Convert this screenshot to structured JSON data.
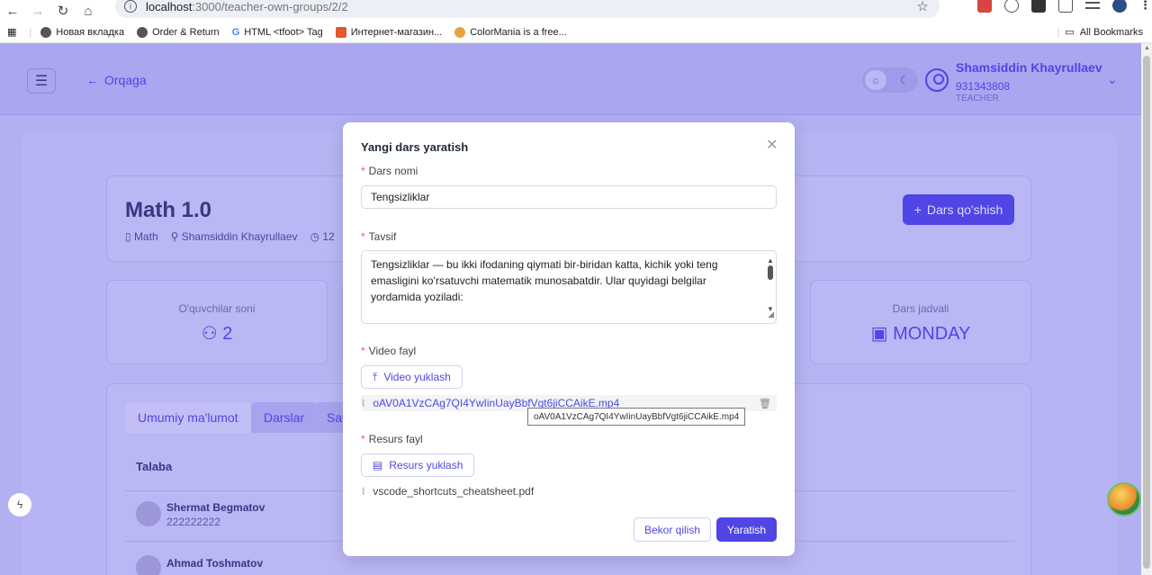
{
  "browser": {
    "url_host": "localhost",
    "url_path": ":3000/teacher-own-groups/2/2",
    "bookmarks": [
      "Новая вкладка",
      "Order & Return",
      "HTML <tfoot> Tag",
      "Интернет-магазин...",
      "ColorMania is a free..."
    ],
    "all_bookmarks": "All Bookmarks"
  },
  "header": {
    "back_label": "Orqaga",
    "user_name": "Shamsiddin Khayrullaev",
    "user_phone": "931343808",
    "user_role": "TEACHER"
  },
  "course": {
    "title": "Math 1.0",
    "subject": "Math",
    "teacher": "Shamsiddin Khayrullaev",
    "time_partial": "12",
    "add_lesson_label": "Dars qo'shish"
  },
  "stats": {
    "students_label": "O'quvchilar soni",
    "students_value": "2",
    "schedule_label": "Dars jadvali",
    "schedule_value": "MONDAY"
  },
  "tabs": [
    "Umumiy ma'lumot",
    "Darslar",
    "Sav"
  ],
  "table": {
    "header": "Talaba",
    "rows": [
      {
        "name": "Shermat Begmatov",
        "phone": "222222222"
      },
      {
        "name": "Ahmad Toshmatov",
        "phone": ""
      }
    ]
  },
  "modal": {
    "title": "Yangi dars yaratish",
    "name_label": "Dars nomi",
    "name_value": "Tengsizliklar",
    "desc_label": "Tavsif",
    "desc_value": "Tengsizliklar — bu ikki ifodaning qiymati bir-biridan katta, kichik yoki teng emasligini koʻrsatuvchi matematik munosabatdir. Ular quyidagi belgilar yordamida yoziladi:",
    "video_label": "Video fayl",
    "video_upload_label": "Video yuklash",
    "video_file": "oAV0A1VzCAg7QI4YwIinUayBbfVgt6jiCCAikE.mp4",
    "resource_label": "Resurs fayl",
    "resource_upload_label": "Resurs yuklash",
    "resource_file": "vscode_shortcuts_cheatsheet.pdf",
    "cancel_label": "Bekor qilish",
    "submit_label": "Yaratish"
  },
  "tooltip": "oAV0A1VzCAg7QI4YwIinUayBbfVgt6jiCCAikE.mp4",
  "colors": {
    "accent": "#4f46e5",
    "backdrop": "#b3b0f2",
    "required": "#ff4d4f"
  }
}
